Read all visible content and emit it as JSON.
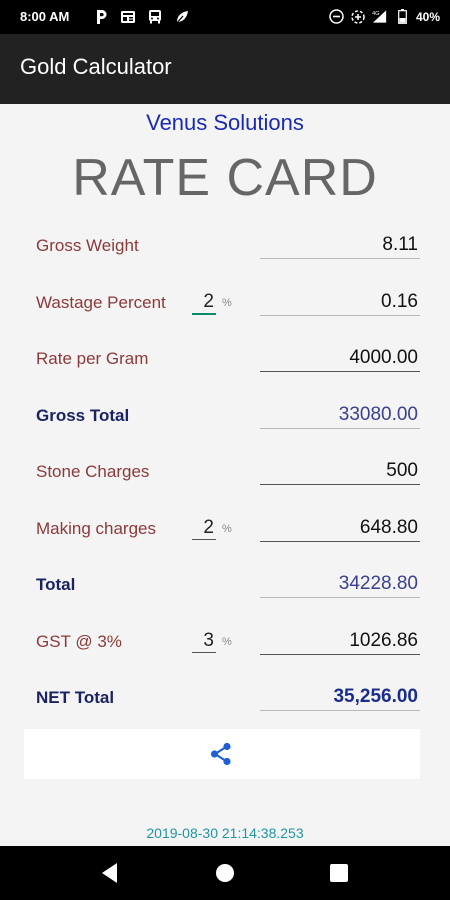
{
  "status": {
    "time": "8:00 AM",
    "battery": "40%",
    "left_icons": [
      "paytm-icon",
      "news-icon",
      "bus-icon",
      "plant-icon"
    ],
    "right_icons": [
      "dnd-icon",
      "data-saver-icon",
      "signal-icon",
      "battery-icon"
    ]
  },
  "appbar": {
    "title": "Gold Calculator"
  },
  "brand": "Venus Solutions",
  "heading": "RATE CARD",
  "rows": {
    "gross_weight": {
      "label": "Gross Weight",
      "value": "8.11"
    },
    "wastage": {
      "label": "Wastage Percent",
      "pct": "2",
      "pct_sign": "%",
      "value": "0.16"
    },
    "rate": {
      "label": "Rate per Gram",
      "value": "4000.00"
    },
    "gross_total": {
      "label": "Gross Total",
      "value": "33080.00"
    },
    "stone": {
      "label": "Stone Charges",
      "value": "500"
    },
    "making": {
      "label": "Making charges",
      "pct": "2",
      "pct_sign": "%",
      "value": "648.80"
    },
    "total": {
      "label": "Total",
      "value": "34228.80"
    },
    "gst": {
      "label": "GST @ 3%",
      "pct": "3",
      "pct_sign": "%",
      "value": "1026.86"
    },
    "net_total": {
      "label": "NET Total",
      "value": "35,256.00"
    }
  },
  "share": {
    "icon": "share-icon"
  },
  "timestamp": "2019-08-30 21:14:38.253",
  "nav": {
    "icons": [
      "back-icon",
      "home-icon",
      "recents-icon"
    ]
  },
  "colors": {
    "brand": "#1a2bb0",
    "label": "#8a3a3a",
    "bold_label": "#1b2461",
    "computed_value": "#3a3f8f",
    "net_value": "#1b2d8a",
    "active_underline": "#0a8a6d",
    "timestamp": "#2196a0",
    "appbar": "#222222"
  }
}
